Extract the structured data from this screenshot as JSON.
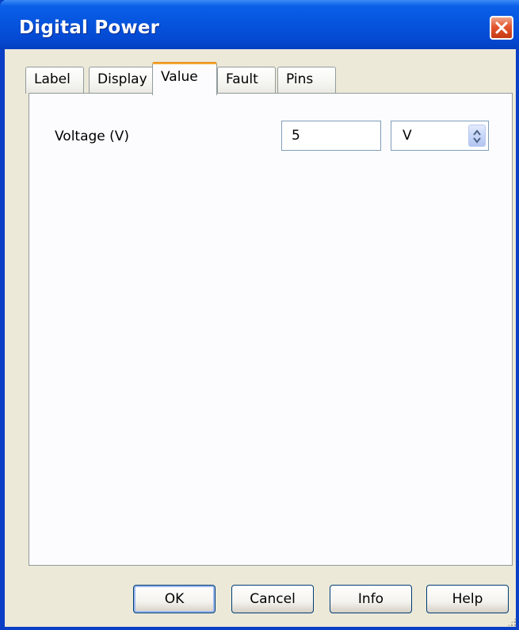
{
  "window": {
    "title": "Digital Power",
    "close_icon": "close-icon"
  },
  "tabs": [
    {
      "label": "Label",
      "active": false
    },
    {
      "label": "Display",
      "active": false
    },
    {
      "label": "Value",
      "active": true
    },
    {
      "label": "Fault",
      "active": false
    },
    {
      "label": "Pins",
      "active": false
    }
  ],
  "value_panel": {
    "voltage_label": "Voltage (V)",
    "voltage_value": "5",
    "unit": "V",
    "unit_spinner_icon": "spin-up-down-icon"
  },
  "buttons": {
    "ok": "OK",
    "cancel": "Cancel",
    "info": "Info",
    "help": "Help"
  },
  "colors": {
    "titlebar": "#0655de",
    "active_tab_accent": "#f3a72b",
    "close_button": "#e4552f"
  }
}
